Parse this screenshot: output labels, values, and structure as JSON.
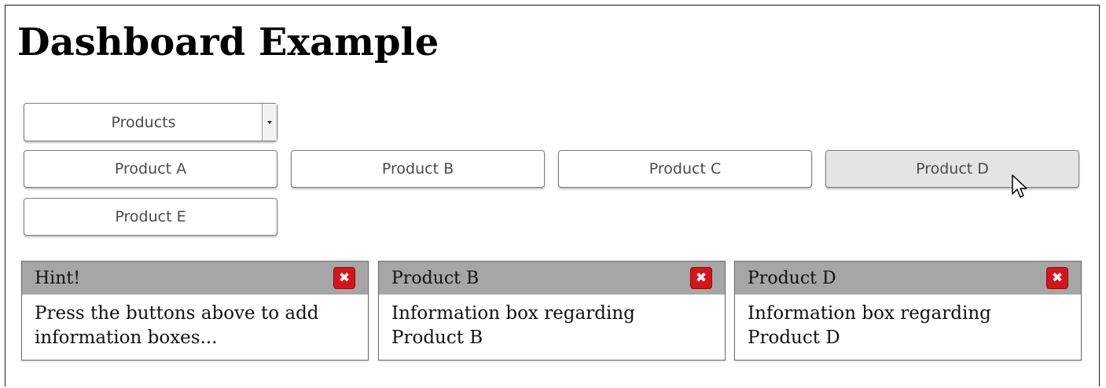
{
  "page": {
    "title": "Dashboard Example"
  },
  "select": {
    "value": "Products"
  },
  "buttons": [
    {
      "label": "Product A"
    },
    {
      "label": "Product B"
    },
    {
      "label": "Product C"
    },
    {
      "label": "Product D"
    },
    {
      "label": "Product E"
    }
  ],
  "boxes": [
    {
      "title": "Hint!",
      "body": "Press the buttons above to add information boxes...",
      "close_icon": "close-icon"
    },
    {
      "title": "Product B",
      "body": "Information box regarding Product B",
      "close_icon": "close-icon"
    },
    {
      "title": "Product D",
      "body": "Information box regarding Product D",
      "close_icon": "close-icon"
    }
  ],
  "colors": {
    "box_header": "#a6a6a6",
    "close_button": "#d8141b",
    "hover_button": "#e4e4e4"
  }
}
